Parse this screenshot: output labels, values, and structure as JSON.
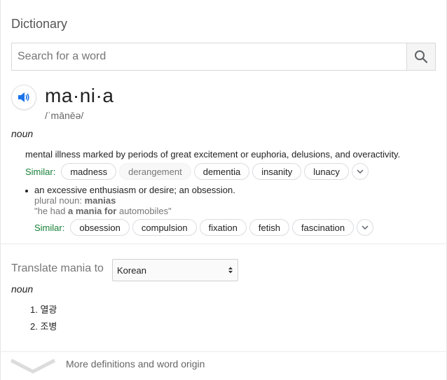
{
  "title": "Dictionary",
  "search": {
    "placeholder": "Search for a word",
    "value": ""
  },
  "entry": {
    "word": "ma·ni·a",
    "phonetic": "/ˈmānēə/",
    "part_of_speech": "noun",
    "senses": [
      {
        "definition": "mental illness marked by periods of great excitement or euphoria, delusions, and overactivity.",
        "similar_label": "Similar:",
        "similar": [
          "madness",
          "derangement",
          "dementia",
          "insanity",
          "lunacy"
        ]
      },
      {
        "definition": "an excessive enthusiasm or desire; an obsession.",
        "plural_label": "plural noun:",
        "plural": "manias",
        "example_pre": "\"he had ",
        "example_bold": "a mania for",
        "example_post": " automobiles\"",
        "similar_label": "Similar:",
        "similar": [
          "obsession",
          "compulsion",
          "fixation",
          "fetish",
          "fascination"
        ]
      }
    ]
  },
  "translate": {
    "label": "Translate mania to",
    "language": "Korean",
    "part_of_speech": "noun",
    "items": [
      "1. 열광",
      "2. 조병"
    ]
  },
  "more": {
    "label": "More definitions and word origin"
  },
  "icons": {
    "search": "search-icon",
    "speaker": "speaker-icon",
    "expand": "chevron-down-icon"
  },
  "colors": {
    "similar_label": "#188038",
    "speaker": "#1a73e8"
  }
}
